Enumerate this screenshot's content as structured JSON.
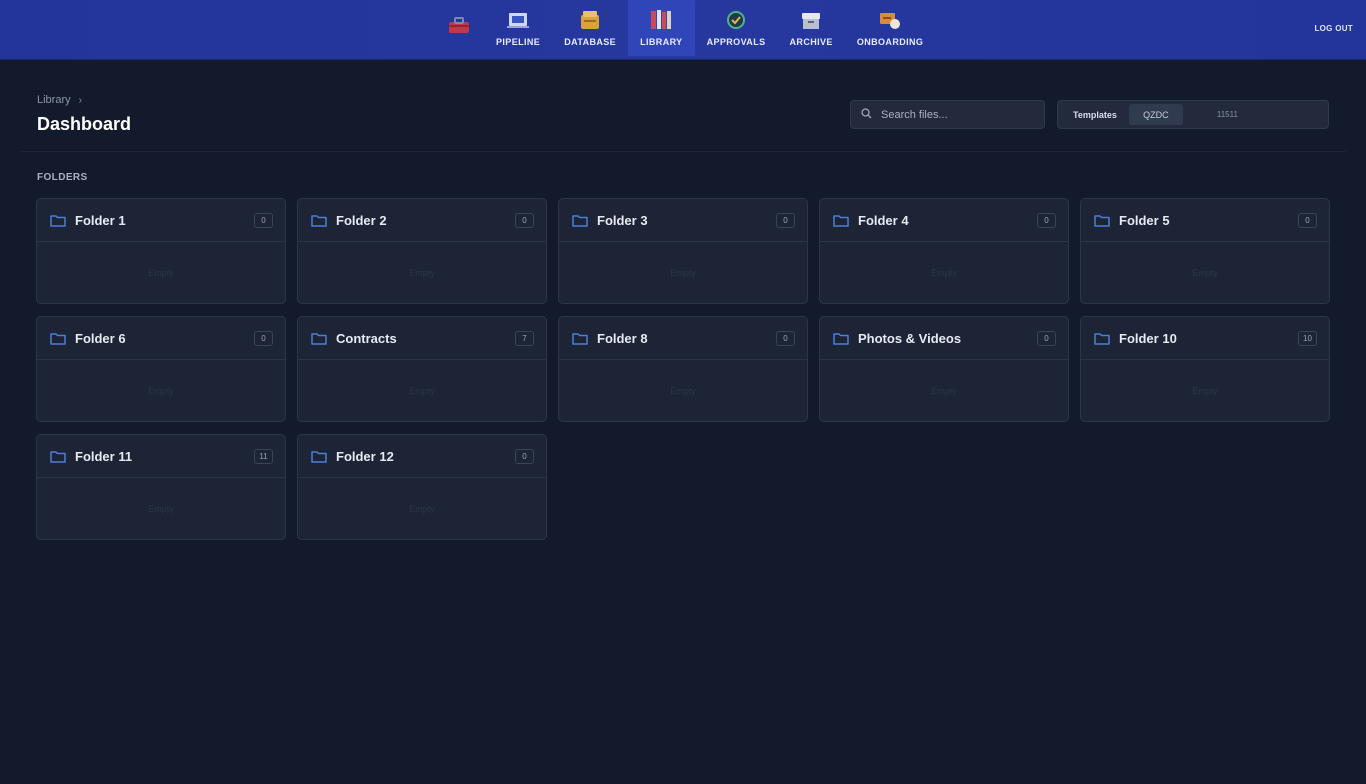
{
  "nav": {
    "items": [
      {
        "label": "",
        "icon": "toolbox-icon",
        "active": false,
        "faded": true
      },
      {
        "label": "PIPELINE",
        "icon": "pipeline-icon",
        "active": false,
        "faded": false
      },
      {
        "label": "DATABASE",
        "icon": "database-icon",
        "active": false,
        "faded": false
      },
      {
        "label": "LIBRARY",
        "icon": "library-icon",
        "active": true,
        "faded": false
      },
      {
        "label": "APPROVALS",
        "icon": "approvals-icon",
        "active": false,
        "faded": false
      },
      {
        "label": "ARCHIVE",
        "icon": "archive-icon",
        "active": false,
        "faded": false
      },
      {
        "label": "ONBOARDING",
        "icon": "onboarding-icon",
        "active": false,
        "faded": false
      }
    ],
    "logout_label": "LOG OUT"
  },
  "breadcrumb": {
    "root": "Library"
  },
  "page_title": "Dashboard",
  "search": {
    "placeholder": "Search files..."
  },
  "toolbar": {
    "templates_label": "Templates",
    "segment_label": "QZDC",
    "count_label": "11511"
  },
  "folders_section_label": "FOLDERS",
  "empty_label": "Empty",
  "folders": [
    {
      "name": "Folder 1",
      "count": "0"
    },
    {
      "name": "Folder 2",
      "count": "0"
    },
    {
      "name": "Folder 3",
      "count": "0"
    },
    {
      "name": "Folder 4",
      "count": "0"
    },
    {
      "name": "Folder 5",
      "count": "0"
    },
    {
      "name": "Folder 6",
      "count": "0"
    },
    {
      "name": "Contracts",
      "count": "7"
    },
    {
      "name": "Folder 8",
      "count": "0"
    },
    {
      "name": "Photos & Videos",
      "count": "0"
    },
    {
      "name": "Folder 10",
      "count": "10"
    },
    {
      "name": "Folder 11",
      "count": "11"
    },
    {
      "name": "Folder 12",
      "count": "0"
    }
  ],
  "colors": {
    "accent": "#26389e",
    "folder_icon": "#4d7fd6",
    "background": "#131a2b"
  }
}
